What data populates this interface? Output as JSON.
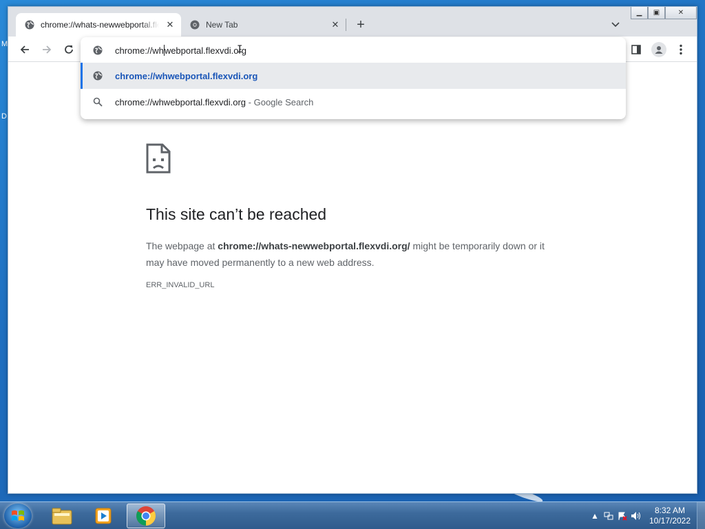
{
  "desktop": {
    "left_glyph_top": "M",
    "left_glyph_mid": "D"
  },
  "browser": {
    "tabs": [
      {
        "title": "chrome://whats-newwebportal.flexvdi.org/",
        "icon": "globe-icon",
        "active": true
      },
      {
        "title": "New Tab",
        "icon": "chrome-icon",
        "active": false
      }
    ],
    "new_tab_symbol": "+",
    "close_symbol": "✕",
    "window_buttons": {
      "minimize": "▁",
      "maximize": "▣",
      "close": "✕"
    }
  },
  "omnibox": {
    "typed_before_caret": "chrome://wh",
    "typed_after_caret": "webportal.flexvdi.org",
    "suggestions": [
      {
        "icon": "globe-icon",
        "text": "chrome://whwebportal.flexvdi.org",
        "suffix": ""
      },
      {
        "icon": "search-icon",
        "text": "chrome://whwebportal.flexvdi.org",
        "suffix": "- Google Search"
      }
    ]
  },
  "error_page": {
    "title": "This site can’t be reached",
    "body_prefix": "The webpage at ",
    "url": "chrome://whats-newwebportal.flexvdi.org/",
    "body_suffix": " might be temporarily down or it may have moved permanently to a new web address.",
    "error_code": "ERR_INVALID_URL"
  },
  "taskbar": {
    "apps": [
      "file-explorer-icon",
      "media-player-icon",
      "chrome-icon"
    ],
    "clock_time": "8:32 AM",
    "clock_date": "10/17/2022"
  },
  "colors": {
    "accent": "#1a73e8",
    "suggestion_link": "#1a56b8",
    "tabstrip": "#dee1e6"
  }
}
